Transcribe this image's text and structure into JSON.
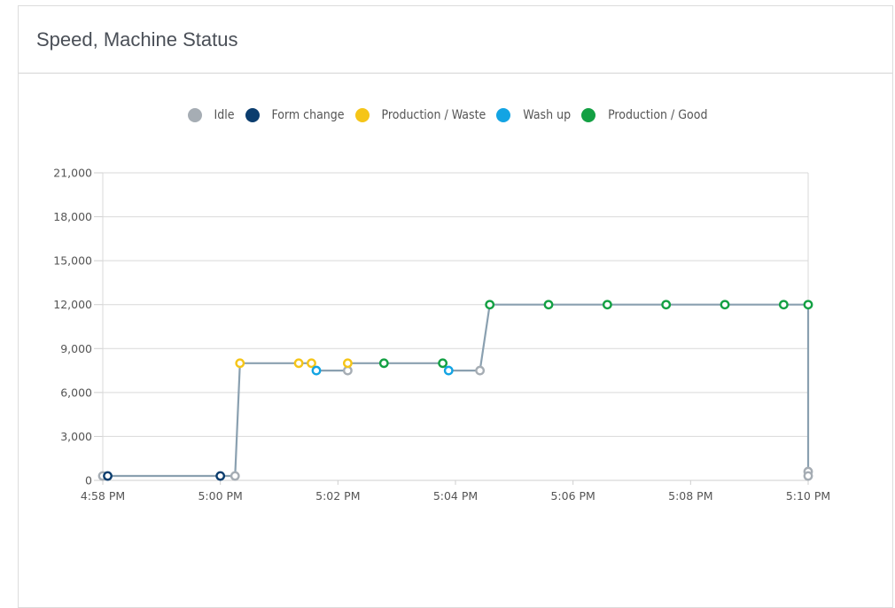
{
  "card": {
    "title": "Speed, Machine Status"
  },
  "legend": [
    {
      "label": "Idle",
      "color": "#a6adb4"
    },
    {
      "label": "Form change",
      "color": "#0b3d6e"
    },
    {
      "label": "Production / Waste",
      "color": "#f5c518"
    },
    {
      "label": "Wash up",
      "color": "#13a4e3"
    },
    {
      "label": "Production / Good",
      "color": "#13a043"
    }
  ],
  "chart_data": {
    "type": "line",
    "title": "Speed, Machine Status",
    "xlabel": "",
    "ylabel": "",
    "y_ticks": [
      "0",
      "3,000",
      "6,000",
      "9,000",
      "12,000",
      "15,000",
      "18,000",
      "21,000"
    ],
    "ylim": [
      0,
      21000
    ],
    "x_ticks": [
      "4:58 PM",
      "5:00 PM",
      "5:02 PM",
      "5:04 PM",
      "5:06 PM",
      "5:08 PM",
      "5:10 PM"
    ],
    "xlim": [
      "4:58 PM",
      "5:10 PM"
    ],
    "grid": true,
    "legend_position": "top-center",
    "line_color": "#8aa0b0",
    "series": [
      {
        "name": "Speed",
        "points": [
          {
            "time": "4:58 PM",
            "value": 300,
            "status": "Idle"
          },
          {
            "time": "4:58:05 PM",
            "value": 300,
            "status": "Form change"
          },
          {
            "time": "5:00 PM",
            "value": 300,
            "status": "Form change"
          },
          {
            "time": "5:00:15 PM",
            "value": 300,
            "status": "Idle"
          },
          {
            "time": "5:00:20 PM",
            "value": 8000,
            "status": "Production / Waste"
          },
          {
            "time": "5:01:20 PM",
            "value": 8000,
            "status": "Production / Waste"
          },
          {
            "time": "5:01:33 PM",
            "value": 8000,
            "status": "Production / Waste"
          },
          {
            "time": "5:01:38 PM",
            "value": 7500,
            "status": "Wash up"
          },
          {
            "time": "5:02:10 PM",
            "value": 7500,
            "status": "Idle"
          },
          {
            "time": "5:02:10 PM",
            "value": 8000,
            "status": "Production / Waste"
          },
          {
            "time": "5:02:47 PM",
            "value": 8000,
            "status": "Production / Good"
          },
          {
            "time": "5:03:47 PM",
            "value": 8000,
            "status": "Production / Good"
          },
          {
            "time": "5:03:53 PM",
            "value": 7500,
            "status": "Wash up"
          },
          {
            "time": "5:04:25 PM",
            "value": 7500,
            "status": "Idle"
          },
          {
            "time": "5:04:35 PM",
            "value": 12000,
            "status": "Production / Good"
          },
          {
            "time": "5:05:35 PM",
            "value": 12000,
            "status": "Production / Good"
          },
          {
            "time": "5:06:35 PM",
            "value": 12000,
            "status": "Production / Good"
          },
          {
            "time": "5:07:35 PM",
            "value": 12000,
            "status": "Production / Good"
          },
          {
            "time": "5:08:35 PM",
            "value": 12000,
            "status": "Production / Good"
          },
          {
            "time": "5:09:35 PM",
            "value": 12000,
            "status": "Production / Good"
          },
          {
            "time": "5:10 PM",
            "value": 12000,
            "status": "Production / Good"
          },
          {
            "time": "5:10 PM",
            "value": 600,
            "status": "Idle"
          },
          {
            "time": "5:10 PM",
            "value": 300,
            "status": "Idle"
          }
        ]
      }
    ]
  }
}
